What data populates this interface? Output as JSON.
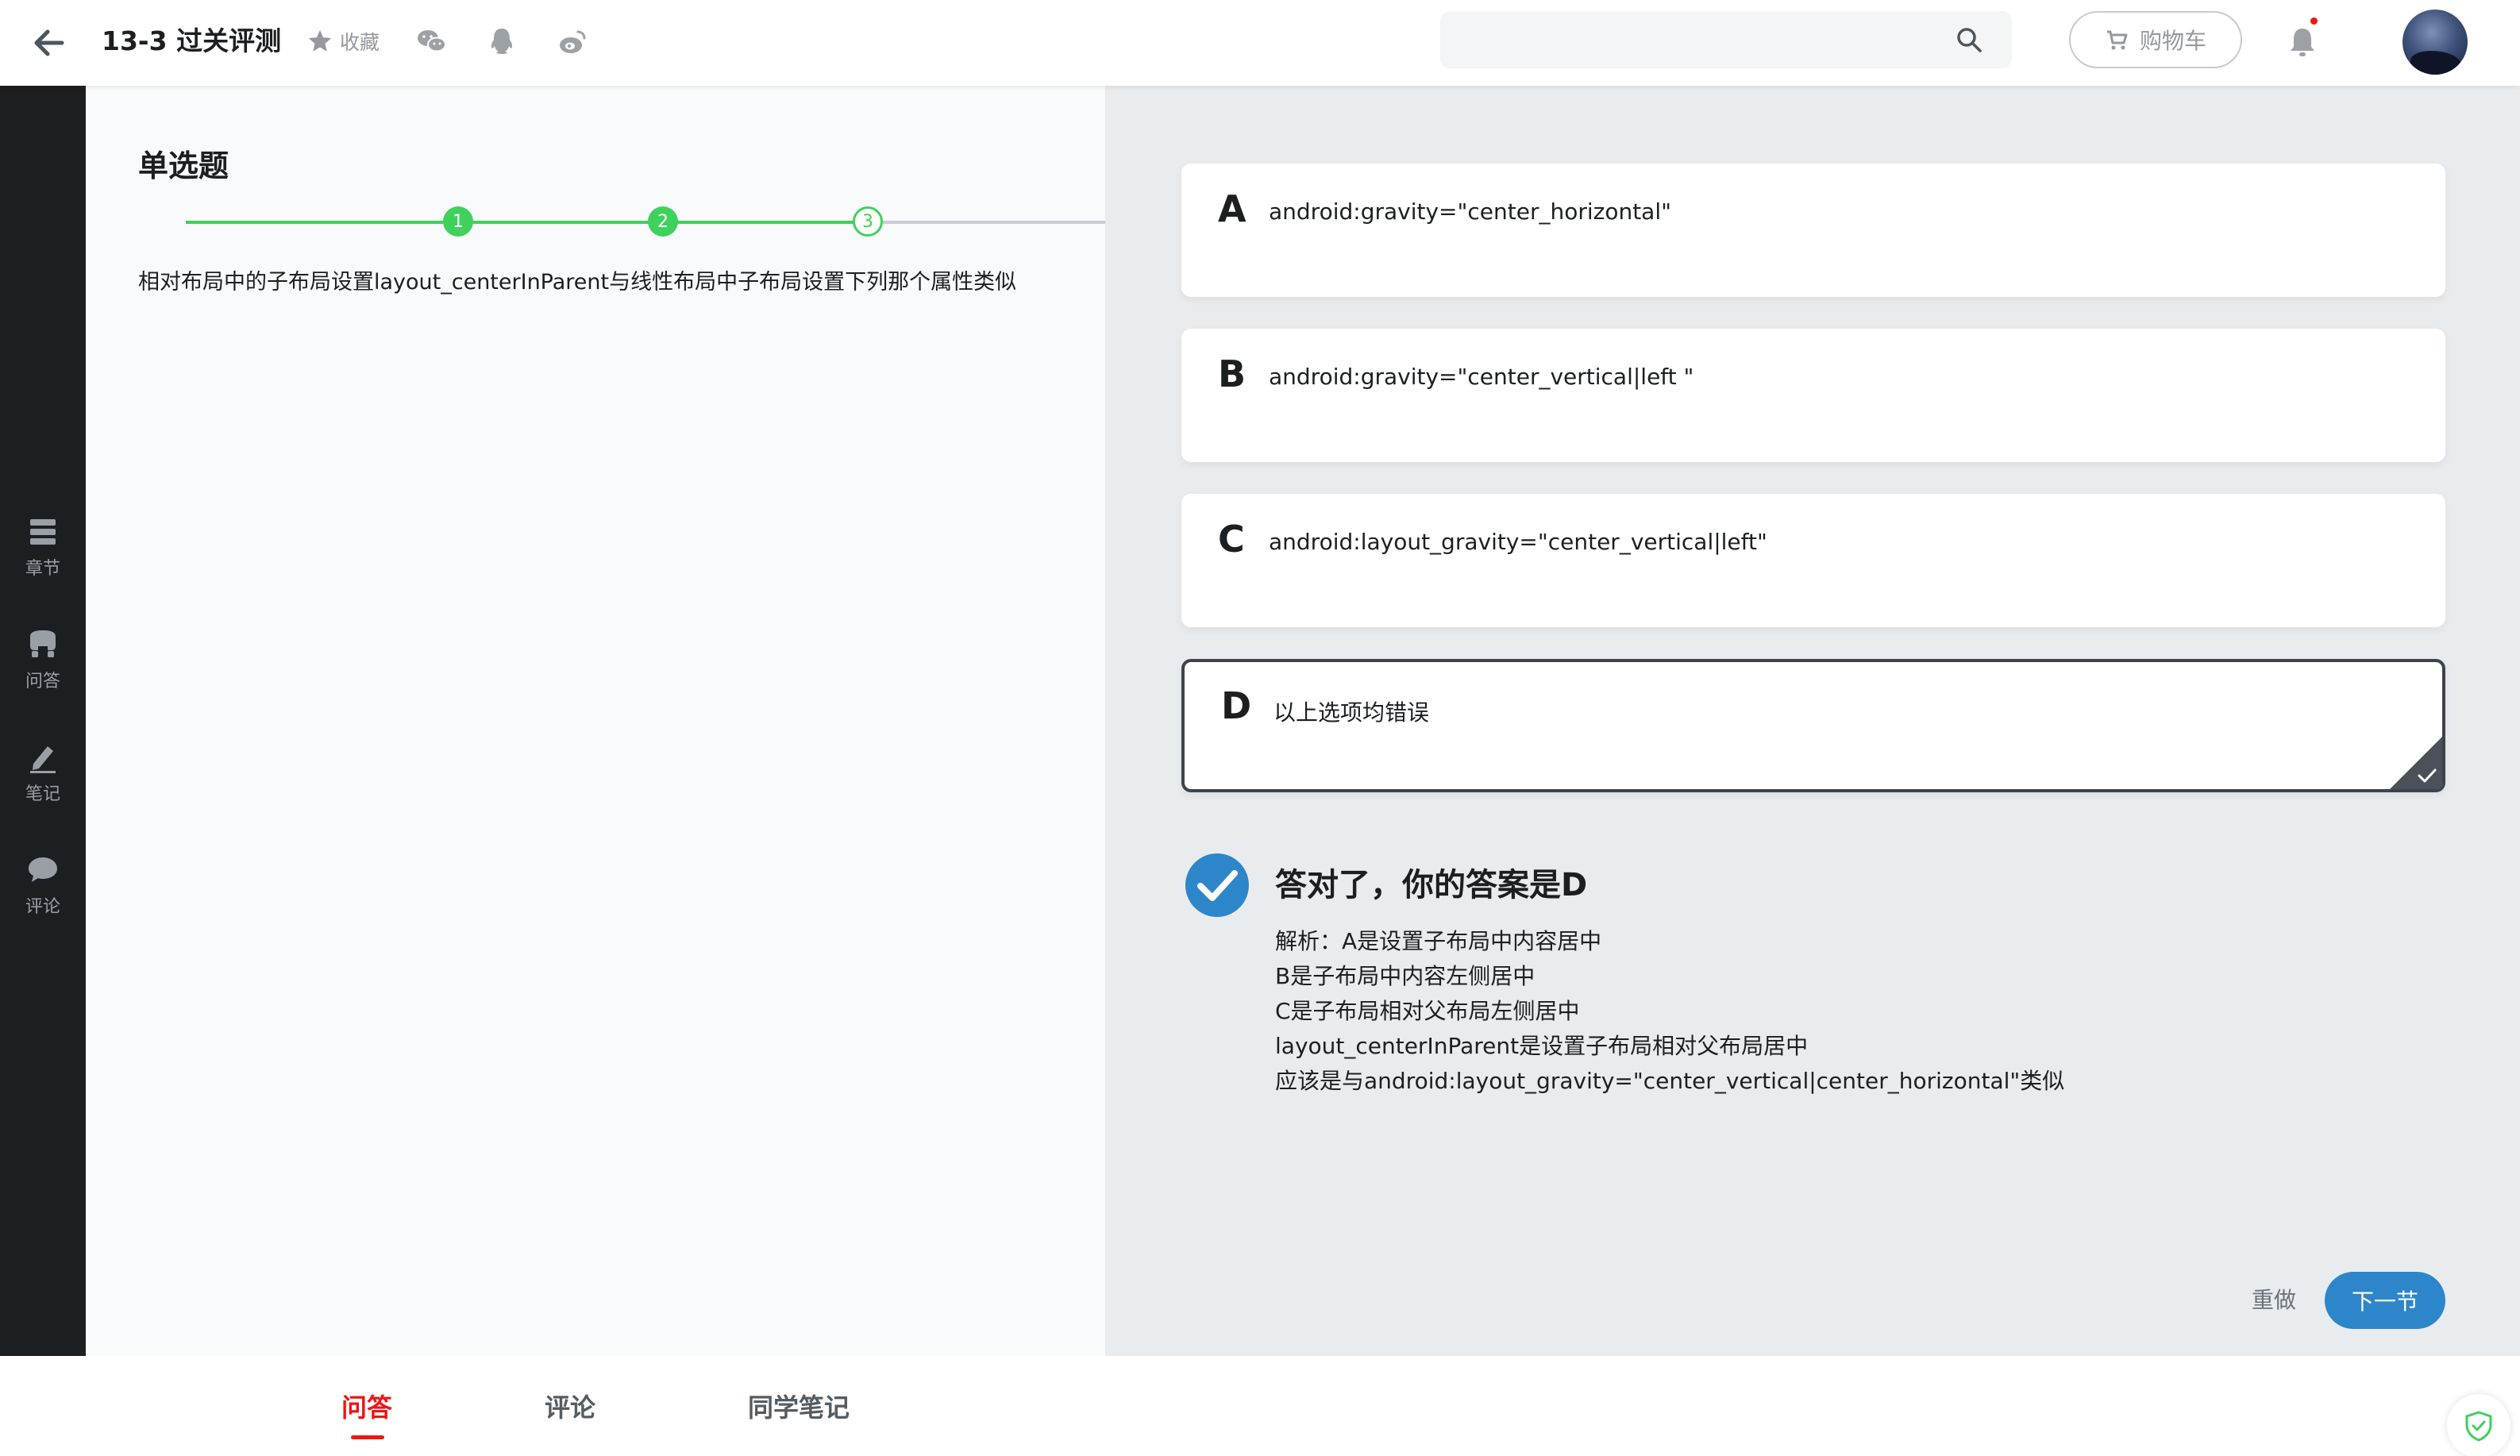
{
  "header": {
    "title": "13-3 过关评测",
    "favorite_label": "收藏",
    "search_placeholder": "",
    "cart_label": "购物车"
  },
  "sidebar": {
    "items": [
      {
        "label": "章节",
        "icon": "chapter-icon"
      },
      {
        "label": "问答",
        "icon": "qa-icon"
      },
      {
        "label": "笔记",
        "icon": "note-icon"
      },
      {
        "label": "评论",
        "icon": "comment-icon"
      }
    ]
  },
  "question": {
    "type": "单选题",
    "steps": [
      "1",
      "2",
      "3"
    ],
    "current_step": 3,
    "text": "相对布局中的子布局设置layout_centerInParent与线性布局中子布局设置下列那个属性类似"
  },
  "options": [
    {
      "letter": "A",
      "text": "android:gravity=\"center_horizontal\""
    },
    {
      "letter": "B",
      "text": "android:gravity=\"center_vertical|left \""
    },
    {
      "letter": "C",
      "text": "android:layout_gravity=\"center_vertical|left\""
    },
    {
      "letter": "D",
      "text": "以上选项均错误",
      "selected": true
    }
  ],
  "result": {
    "title": "答对了，你的答案是D",
    "analysis": [
      "解析：A是设置子布局中内容居中",
      "B是子布局中内容左侧居中",
      "C是子布局相对父布局左侧居中",
      "layout_centerInParent是设置子布局相对父布局居中",
      "应该是与android:layout_gravity=\"center_vertical|center_horizontal\"类似"
    ]
  },
  "actions": {
    "redo_label": "重做",
    "next_label": "下一节"
  },
  "bottom_tabs": [
    {
      "label": "问答",
      "active": true
    },
    {
      "label": "评论",
      "active": false
    },
    {
      "label": "同学笔记",
      "active": false
    }
  ],
  "colors": {
    "step_done": "#3fd15b",
    "accent_red": "#f01414",
    "primary_blue": "#2d86c9",
    "sidebar_bg": "#1c1f21"
  }
}
